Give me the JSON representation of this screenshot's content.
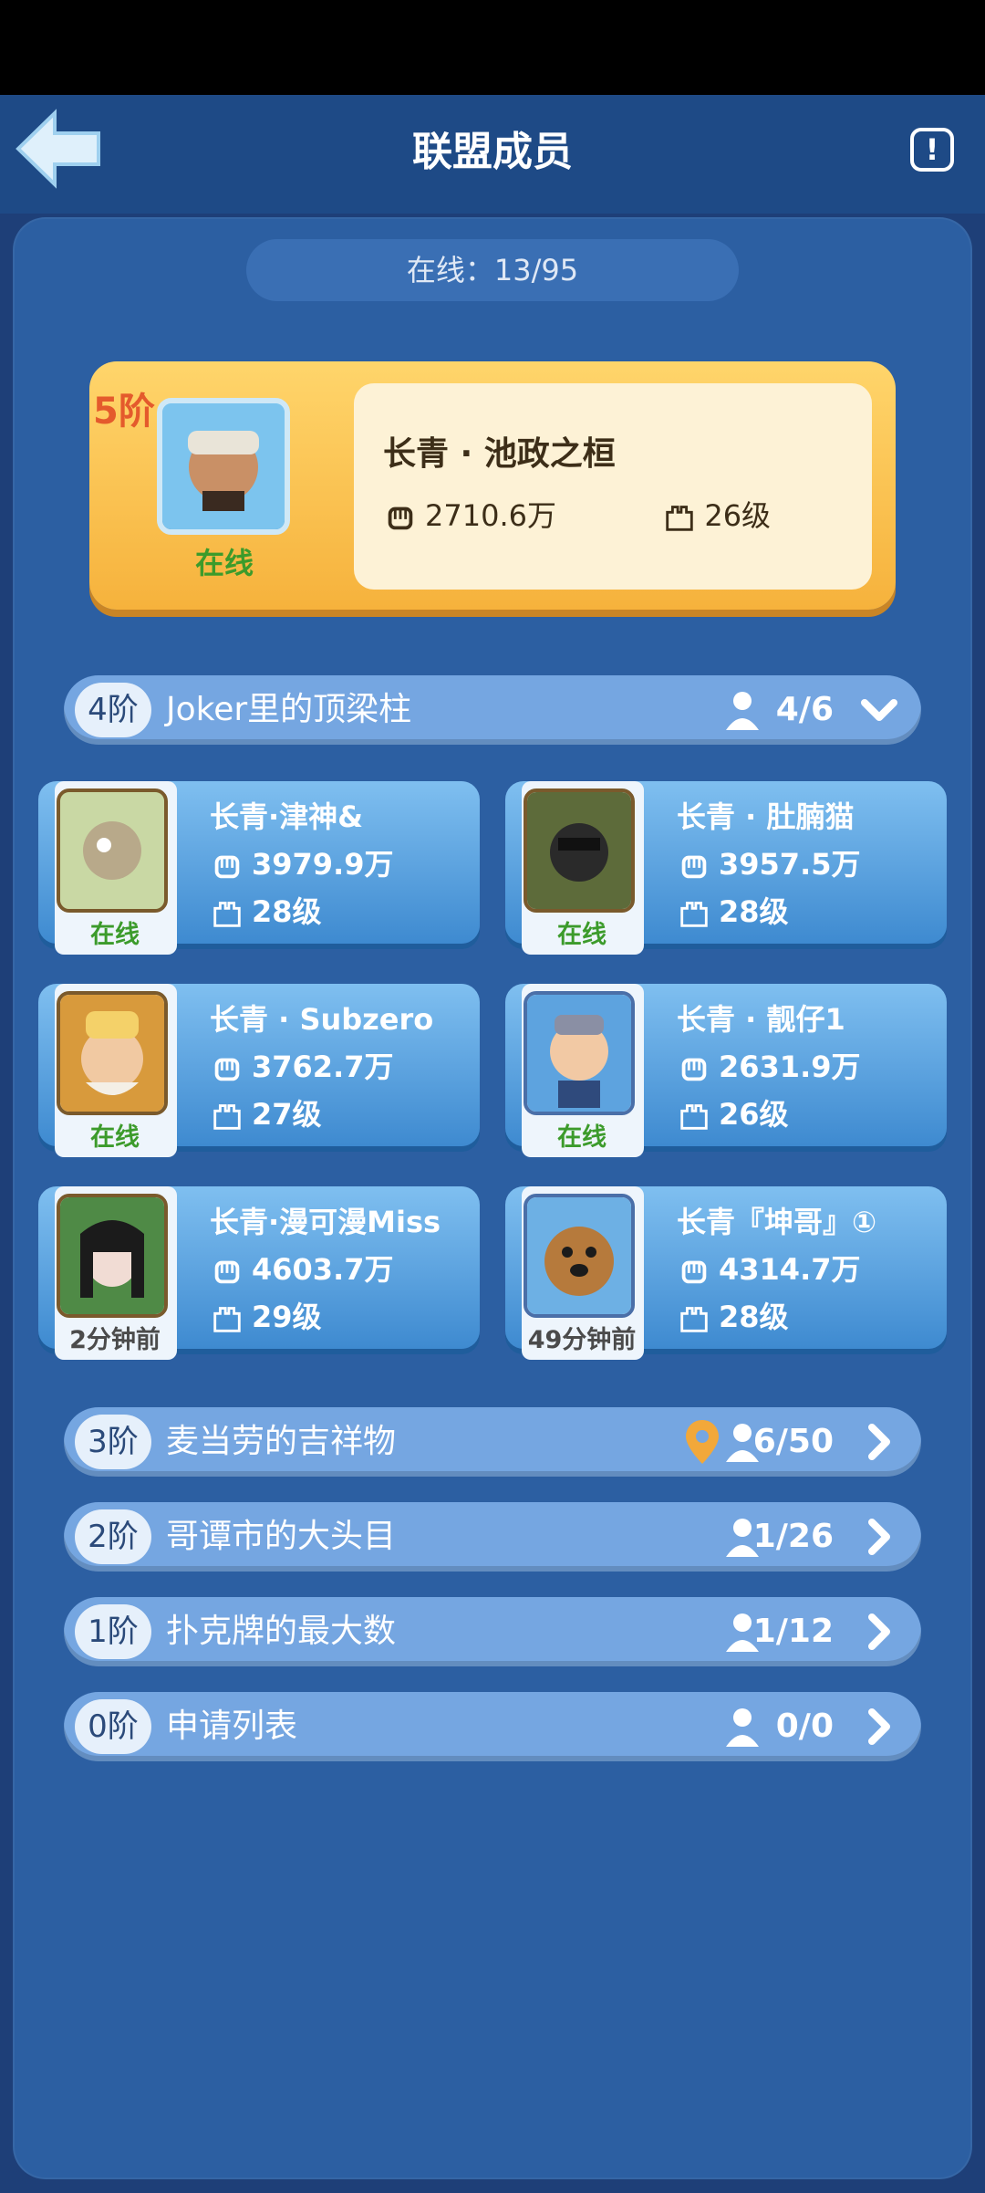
{
  "header": {
    "title": "联盟成员"
  },
  "online": "在线：13/95",
  "leader": {
    "rank": "5阶",
    "name": "长青 · 池政之桓",
    "power": "2710.6万",
    "level": "26级",
    "status": "在线"
  },
  "tiers": [
    {
      "rank": "4阶",
      "label": "Joker里的顶梁柱",
      "count": "4/6",
      "expanded": true
    },
    {
      "rank": "3阶",
      "label": "麦当劳的吉祥物",
      "count": "6/50",
      "has_pin": true
    },
    {
      "rank": "2阶",
      "label": "哥谭市的大头目",
      "count": "1/26"
    },
    {
      "rank": "1阶",
      "label": "扑克牌的最大数",
      "count": "1/12"
    },
    {
      "rank": "0阶",
      "label": "申请列表",
      "count": "0/0"
    }
  ],
  "members": [
    {
      "name": "长青·津神&",
      "power": "3979.9万",
      "level": "28级",
      "status": "在线",
      "online": true
    },
    {
      "name": "长青 · 肚腩猫",
      "power": "3957.5万",
      "level": "28级",
      "status": "在线",
      "online": true
    },
    {
      "name": "长青 · Subzero",
      "power": "3762.7万",
      "level": "27级",
      "status": "在线",
      "online": true
    },
    {
      "name": "长青 · 靓仔1",
      "power": "2631.9万",
      "level": "26级",
      "status": "在线",
      "online": true
    },
    {
      "name": "长青·漫可漫Miss",
      "power": "4603.7万",
      "level": "29级",
      "status": "2分钟前",
      "online": false
    },
    {
      "name": "长青『坤哥』①",
      "power": "4314.7万",
      "level": "28级",
      "status": "49分钟前",
      "online": false
    }
  ],
  "colors": {
    "panel": "#2c5fa2",
    "tier": "#75a6e1",
    "leader_card": "#f6b23c",
    "online_green": "#3c9b2b"
  }
}
